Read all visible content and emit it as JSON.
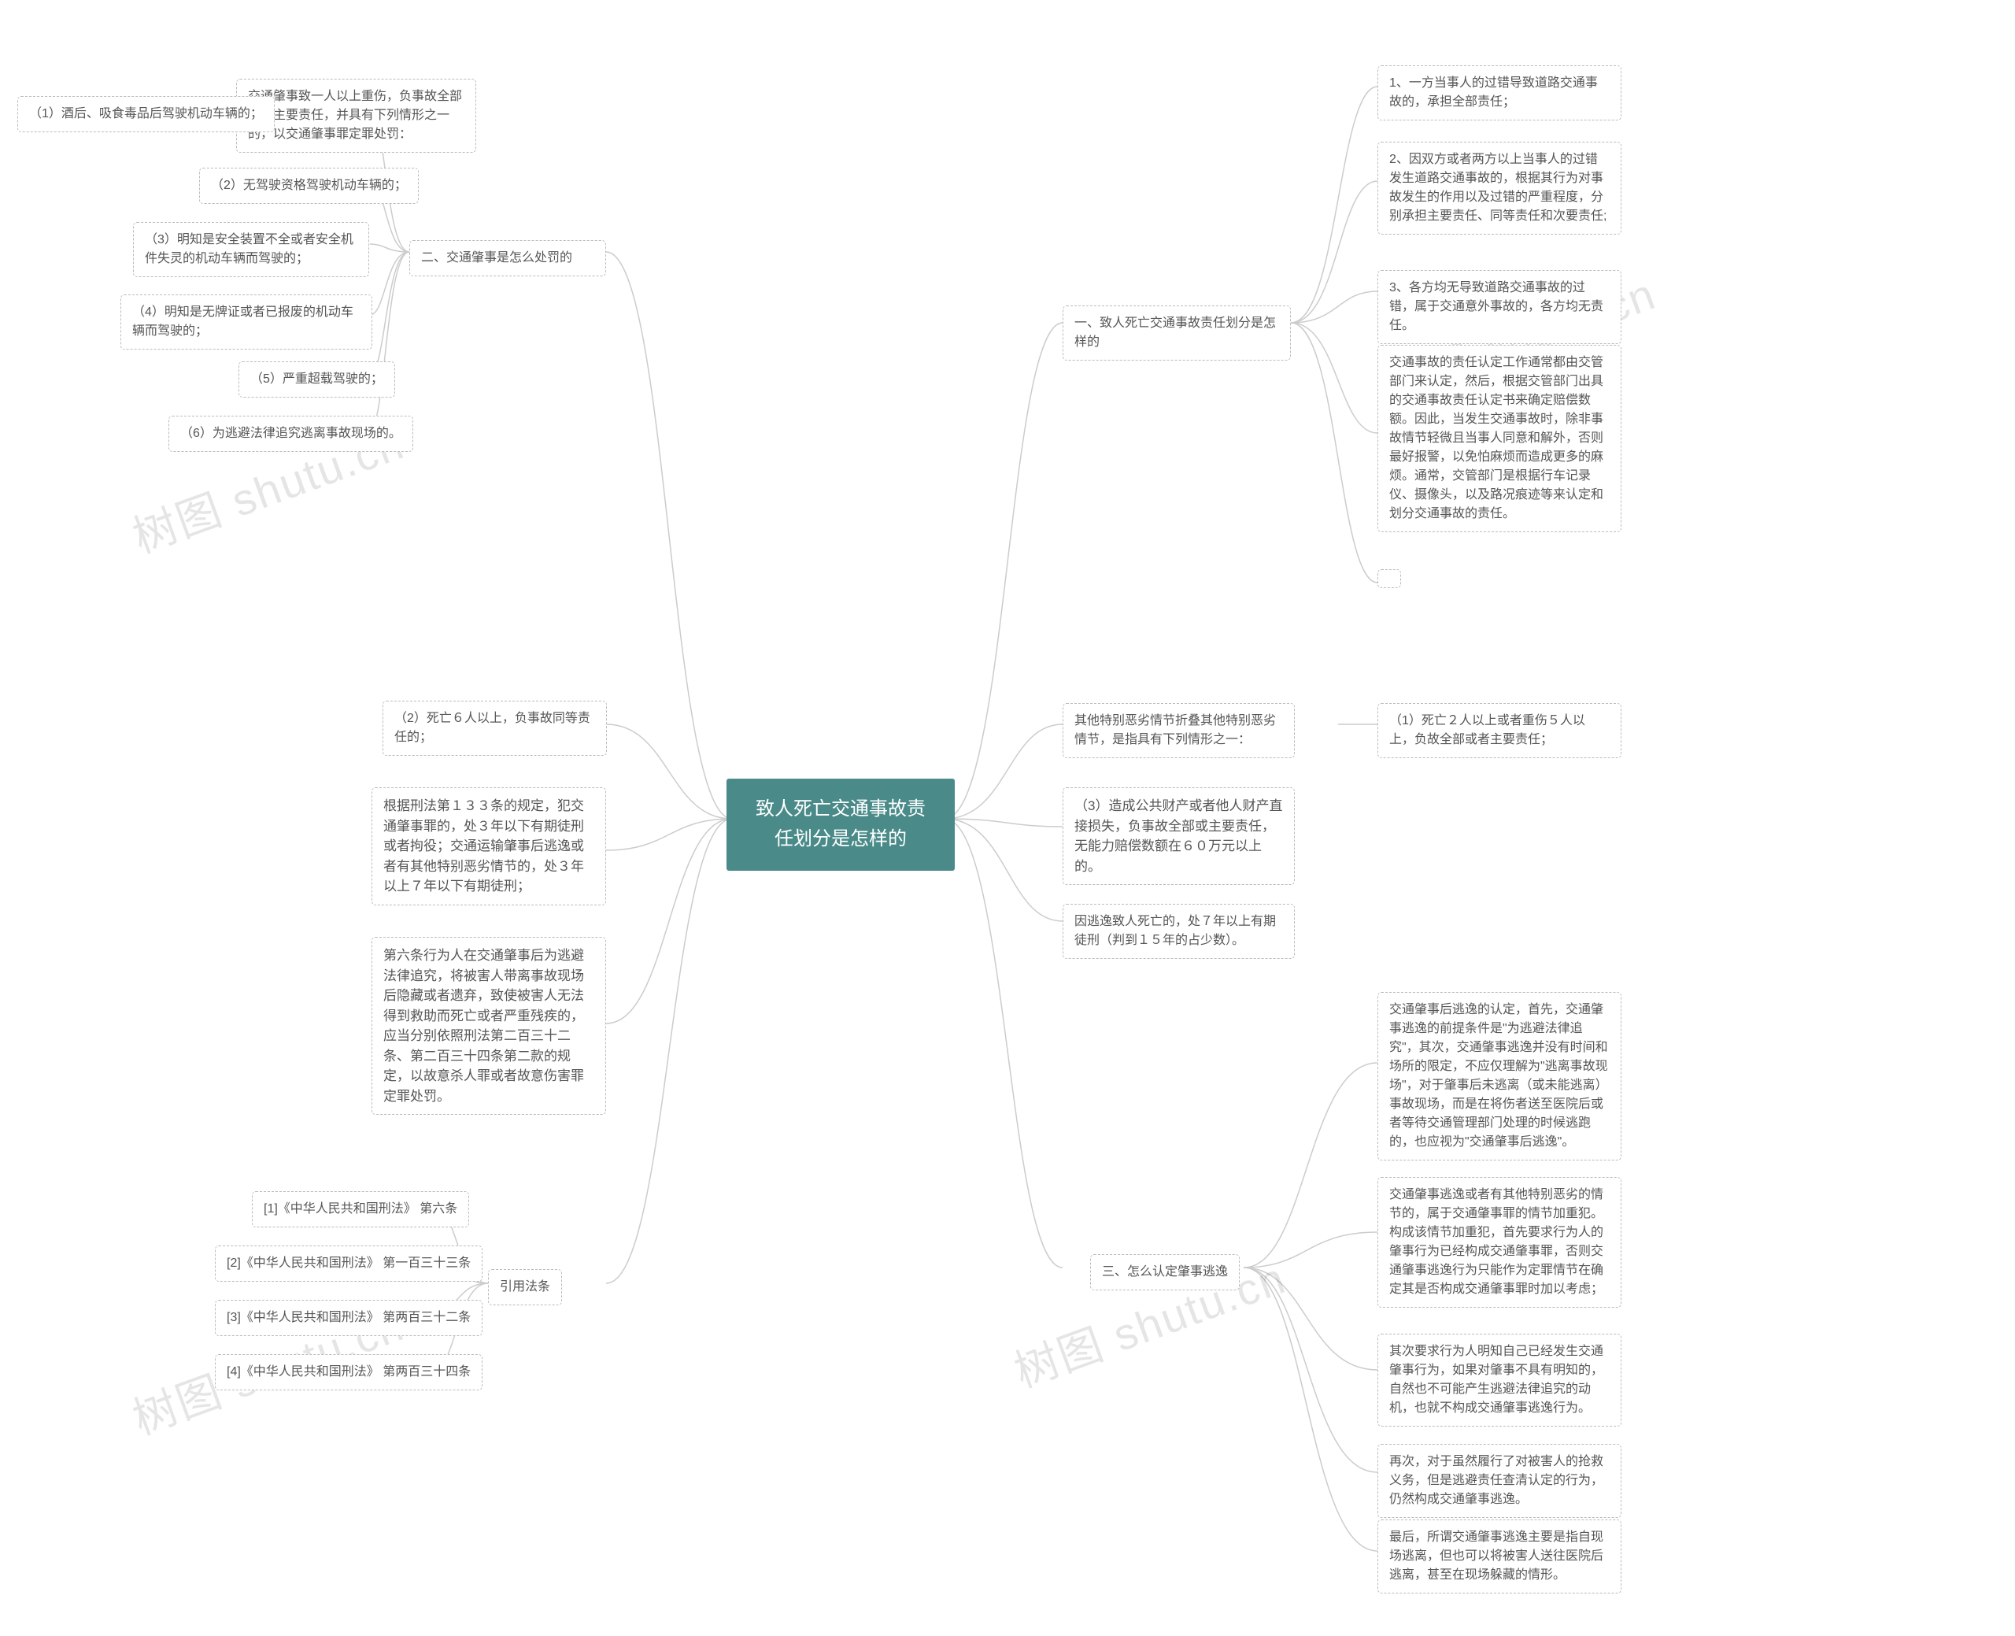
{
  "root": "致人死亡交通事故责任划分是怎样的",
  "watermarks": [
    "树图 shutu.cn",
    "树图 shutu.cn",
    "树图 shutu.cn",
    "树图 shutu.cn"
  ],
  "left": {
    "section2": {
      "title": "二、交通肇事是怎么处罚的",
      "top_block": "交通肇事致一人以上重伤，负事故全部或者主要责任，并具有下列情形之一的，以交通肇事罪定罪处罚：",
      "items": [
        "（1）酒后、吸食毒品后驾驶机动车辆的；",
        "（2）无驾驶资格驾驶机动车辆的；",
        "（3）明知是安全装置不全或者安全机件失灵的机动车辆而驾驶的；",
        "（4）明知是无牌证或者已报废的机动车辆而驾驶的；",
        "（5）严重超载驾驶的；",
        "（6）为逃避法律追究逃离事故现场的。"
      ],
      "block_death6": "（2）死亡６人以上，负事故同等责任的；",
      "block_133": "根据刑法第１３３条的规定，犯交通肇事罪的，处３年以下有期徒刑或者拘役；交通运输肇事后逃逸或者有其他特别恶劣情节的，处３年以上７年以下有期徒刑；",
      "block_article6": "第六条行为人在交通肇事后为逃避法律追究，将被害人带离事故现场后隐藏或者遗弃，致使被害人无法得到救助而死亡或者严重残疾的，应当分别依照刑法第二百三十二条、第二百三十四条第二款的规定，以故意杀人罪或者故意伤害罪定罪处罚。"
    },
    "references": {
      "title": "引用法条",
      "items": [
        "[1]《中华人民共和国刑法》 第六条",
        "[2]《中华人民共和国刑法》 第一百三十三条",
        "[3]《中华人民共和国刑法》 第两百三十二条",
        "[4]《中华人民共和国刑法》 第两百三十四条"
      ]
    }
  },
  "right": {
    "section1": {
      "title": "一、致人死亡交通事故责任划分是怎样的",
      "items": [
        "1、一方当事人的过错导致道路交通事故的，承担全部责任；",
        "2、因双方或者两方以上当事人的过错发生道路交通事故的，根据其行为对事故发生的作用以及过错的严重程度，分别承担主要责任、同等责任和次要责任;",
        "3、各方均无导致道路交通事故的过错，属于交通意外事故的，各方均无责任。",
        "交通事故的责任认定工作通常都由交管部门来认定，然后，根据交管部门出具的交通事故责任认定书来确定赔偿数额。因此，当发生交通事故时，除非事故情节轻微且当事人同意和解外，否则最好报警，以免怕麻烦而造成更多的麻烦。通常，交管部门是根据行车记录仪、摄像头，以及路况痕迹等来认定和划分交通事故的责任。"
      ]
    },
    "block_severe": "其他特别恶劣情节折叠其他特别恶劣情节，是指具有下列情形之一：",
    "block_severe_sub": "（1）死亡２人以上或者重伤５人以上，负故全部或者主要责任；",
    "block_property": "（3）造成公共财产或者他人财产直接损失，负事故全部或主要责任，无能力赔偿数额在６０万元以上的。",
    "block_escape_death": "因逃逸致人死亡的，处７年以上有期徒刑（判到１５年的占少数）。",
    "section3": {
      "title": "三、怎么认定肇事逃逸",
      "items": [
        "交通肇事后逃逸的认定，首先，交通肇事逃逸的前提条件是\"为逃避法律追究\"，其次，交通肇事逃逸并没有时间和场所的限定，不应仅理解为\"逃离事故现场\"，对于肇事后未逃离（或未能逃离）事故现场，而是在将伤者送至医院后或者等待交通管理部门处理的时候逃跑的，也应视为\"交通肇事后逃逸\"。",
        "交通肇事逃逸或者有其他特别恶劣的情节的，属于交通肇事罪的情节加重犯。构成该情节加重犯，首先要求行为人的肇事行为已经构成交通肇事罪，否则交通肇事逃逸行为只能作为定罪情节在确定其是否构成交通肇事罪时加以考虑；",
        "其次要求行为人明知自己已经发生交通肇事行为，如果对肇事不具有明知的，自然也不可能产生逃避法律追究的动机，也就不构成交通肇事逃逸行为。",
        "再次，对于虽然履行了对被害人的抢救义务，但是逃避责任查清认定的行为，仍然构成交通肇事逃逸。",
        "最后，所谓交通肇事逃逸主要是指自现场逃离，但也可以将被害人送往医院后逃离，甚至在现场躲藏的情形。"
      ]
    }
  }
}
